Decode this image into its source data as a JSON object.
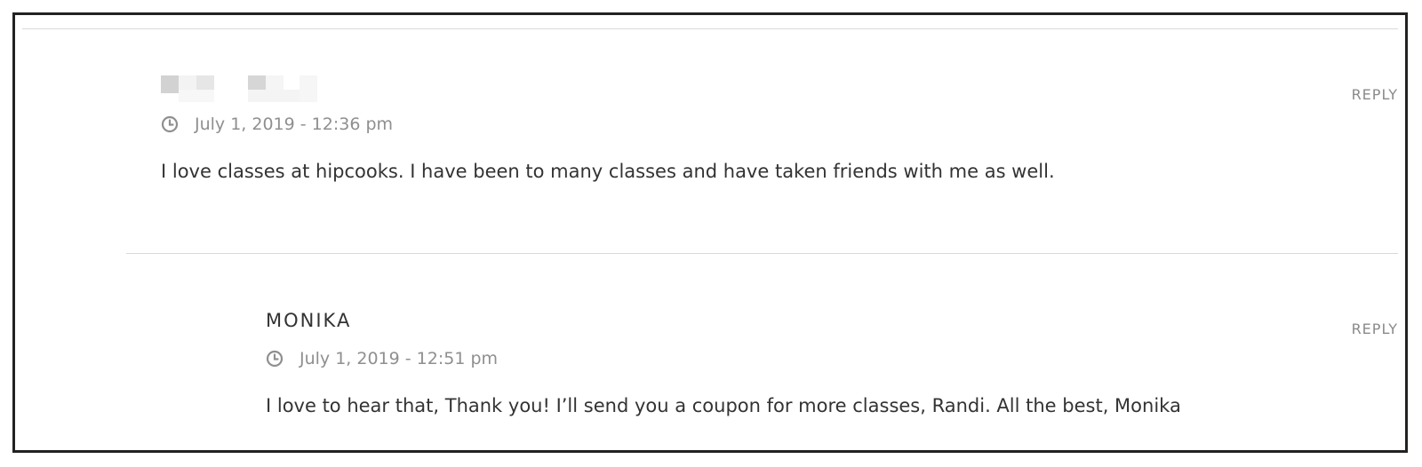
{
  "comments": [
    {
      "author": "",
      "reply_label": "REPLY",
      "date": "July 1, 2019 - 12:36 pm",
      "text": "I love classes at hipcooks. I have been to many classes and have taken friends with me as well."
    },
    {
      "author": "MONIKA",
      "reply_label": "REPLY",
      "date": "July 1, 2019 - 12:51 pm",
      "text": "I love to hear that, Thank you! I’ll send you a coupon for more classes, Randi. All the best, Monika"
    }
  ],
  "icons": {
    "clock": "clock-icon"
  },
  "colors": {
    "text": "#333333",
    "meta": "#8f8f8f",
    "reply": "#8a8a8a",
    "divider": "#d9d9d9"
  }
}
